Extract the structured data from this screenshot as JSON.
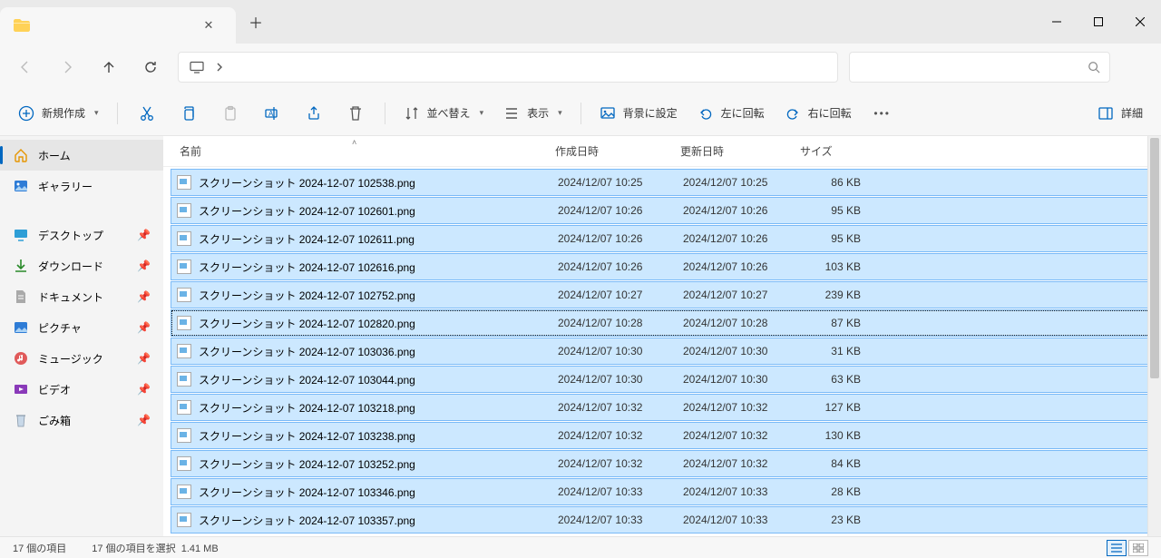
{
  "window": {
    "tab_title": ""
  },
  "toolbar": {
    "new": "新規作成",
    "sort": "並べ替え",
    "view": "表示",
    "set_bg": "背景に設定",
    "rotate_left": "左に回転",
    "rotate_right": "右に回転",
    "details": "詳細"
  },
  "sidebar": {
    "home": "ホーム",
    "gallery": "ギャラリー",
    "desktop": "デスクトップ",
    "downloads": "ダウンロード",
    "documents": "ドキュメント",
    "pictures": "ピクチャ",
    "music": "ミュージック",
    "videos": "ビデオ",
    "recycle": "ごみ箱"
  },
  "columns": {
    "name": "名前",
    "created": "作成日時",
    "modified": "更新日時",
    "size": "サイズ"
  },
  "files": [
    {
      "name": "スクリーンショット 2024-12-07 102538.png",
      "created": "2024/12/07 10:25",
      "modified": "2024/12/07 10:25",
      "size": "86 KB"
    },
    {
      "name": "スクリーンショット 2024-12-07 102601.png",
      "created": "2024/12/07 10:26",
      "modified": "2024/12/07 10:26",
      "size": "95 KB"
    },
    {
      "name": "スクリーンショット 2024-12-07 102611.png",
      "created": "2024/12/07 10:26",
      "modified": "2024/12/07 10:26",
      "size": "95 KB"
    },
    {
      "name": "スクリーンショット 2024-12-07 102616.png",
      "created": "2024/12/07 10:26",
      "modified": "2024/12/07 10:26",
      "size": "103 KB"
    },
    {
      "name": "スクリーンショット 2024-12-07 102752.png",
      "created": "2024/12/07 10:27",
      "modified": "2024/12/07 10:27",
      "size": "239 KB"
    },
    {
      "name": "スクリーンショット 2024-12-07 102820.png",
      "created": "2024/12/07 10:28",
      "modified": "2024/12/07 10:28",
      "size": "87 KB",
      "focused": true
    },
    {
      "name": "スクリーンショット 2024-12-07 103036.png",
      "created": "2024/12/07 10:30",
      "modified": "2024/12/07 10:30",
      "size": "31 KB"
    },
    {
      "name": "スクリーンショット 2024-12-07 103044.png",
      "created": "2024/12/07 10:30",
      "modified": "2024/12/07 10:30",
      "size": "63 KB"
    },
    {
      "name": "スクリーンショット 2024-12-07 103218.png",
      "created": "2024/12/07 10:32",
      "modified": "2024/12/07 10:32",
      "size": "127 KB"
    },
    {
      "name": "スクリーンショット 2024-12-07 103238.png",
      "created": "2024/12/07 10:32",
      "modified": "2024/12/07 10:32",
      "size": "130 KB"
    },
    {
      "name": "スクリーンショット 2024-12-07 103252.png",
      "created": "2024/12/07 10:32",
      "modified": "2024/12/07 10:32",
      "size": "84 KB"
    },
    {
      "name": "スクリーンショット 2024-12-07 103346.png",
      "created": "2024/12/07 10:33",
      "modified": "2024/12/07 10:33",
      "size": "28 KB"
    },
    {
      "name": "スクリーンショット 2024-12-07 103357.png",
      "created": "2024/12/07 10:33",
      "modified": "2024/12/07 10:33",
      "size": "23 KB"
    }
  ],
  "status": {
    "count": "17 個の項目",
    "selected": "17 個の項目を選択",
    "size": "1.41 MB"
  }
}
